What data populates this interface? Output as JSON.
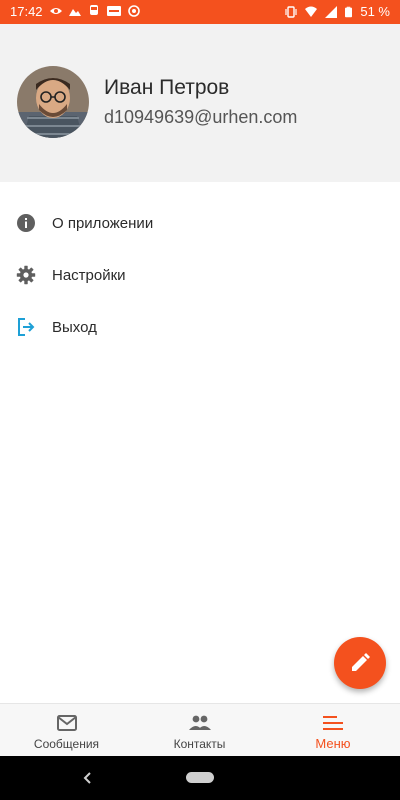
{
  "status_bar": {
    "time": "17:42",
    "battery": "51 %",
    "left_icons": [
      "eye-icon",
      "photo-icon",
      "train-icon",
      "news-icon",
      "target-icon"
    ],
    "right_icons": [
      "vibrate-icon",
      "wifi-icon",
      "signal-icon"
    ]
  },
  "profile": {
    "name": "Иван Петров",
    "email": "d10949639@urhen.com"
  },
  "menu": {
    "items": [
      {
        "label": "О приложении",
        "icon": "info-icon"
      },
      {
        "label": "Настройки",
        "icon": "gear-icon"
      },
      {
        "label": "Выход",
        "icon": "logout-icon"
      }
    ]
  },
  "fab": {
    "icon": "pencil-icon"
  },
  "bottom_nav": {
    "tabs": [
      {
        "label": "Сообщения",
        "icon": "mail-icon"
      },
      {
        "label": "Контакты",
        "icon": "people-icon"
      },
      {
        "label": "Меню",
        "icon": "menu-lines-icon"
      }
    ],
    "active_tab": "Меню"
  },
  "colors": {
    "accent": "#f4511e",
    "header_bg": "#f2f2f2",
    "logout_icon": "#1ea0d6"
  }
}
